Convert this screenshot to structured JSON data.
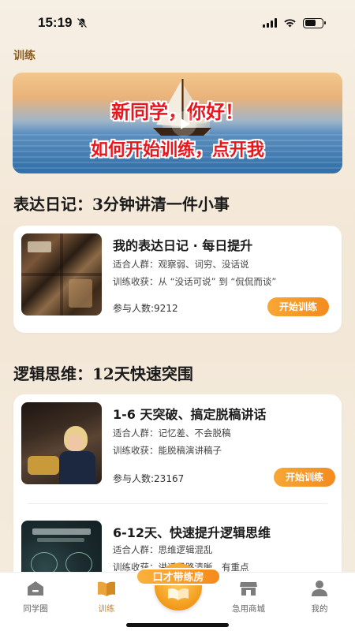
{
  "status_bar": {
    "time": "15:19",
    "icons": [
      "bell-slash-icon",
      "signal-icon",
      "wifi-icon",
      "battery-icon"
    ]
  },
  "page": {
    "title": "训练"
  },
  "banner": {
    "line1": "新同学，你好！",
    "line2": "如何开始训练，点开我"
  },
  "sections": [
    {
      "title": "表达日记：3分钟讲清一件小事",
      "courses": [
        {
          "title": "我的表达日记 · 每日提升",
          "audience": "适合人群：观察弱、词穷、没话说",
          "gain": "训练收获：从 “没话可说” 到 “侃侃而谈”",
          "participants": "参与人数:9212",
          "button": "开始训练"
        }
      ]
    },
    {
      "title": "逻辑思维：12天快速突围",
      "courses": [
        {
          "title": "1-6 天突破、搞定脱稿讲话",
          "audience": "适合人群：记忆差、不会脱稿",
          "gain": "训练收获：能脱稿演讲稿子",
          "participants": "参与人数:23167",
          "button": "开始训练"
        },
        {
          "title": "6-12天、快速提升逻辑思维",
          "audience": "适合人群：思维逻辑混乱",
          "gain": "训练收获：讲话思路清晰、有重点"
        }
      ]
    }
  ],
  "tabbar": {
    "tabs": [
      {
        "label": "同学圈",
        "icon": "classmates-icon"
      },
      {
        "label": "训练",
        "icon": "book-icon",
        "active": true
      },
      {
        "label": "急用商城",
        "icon": "shop-icon"
      },
      {
        "label": "我的",
        "icon": "user-icon"
      }
    ],
    "center_badge": "口才带练房"
  },
  "colors": {
    "accent": "#f48b1f",
    "active_tab": "#c2842e",
    "title_brown": "#8b5a1e"
  }
}
